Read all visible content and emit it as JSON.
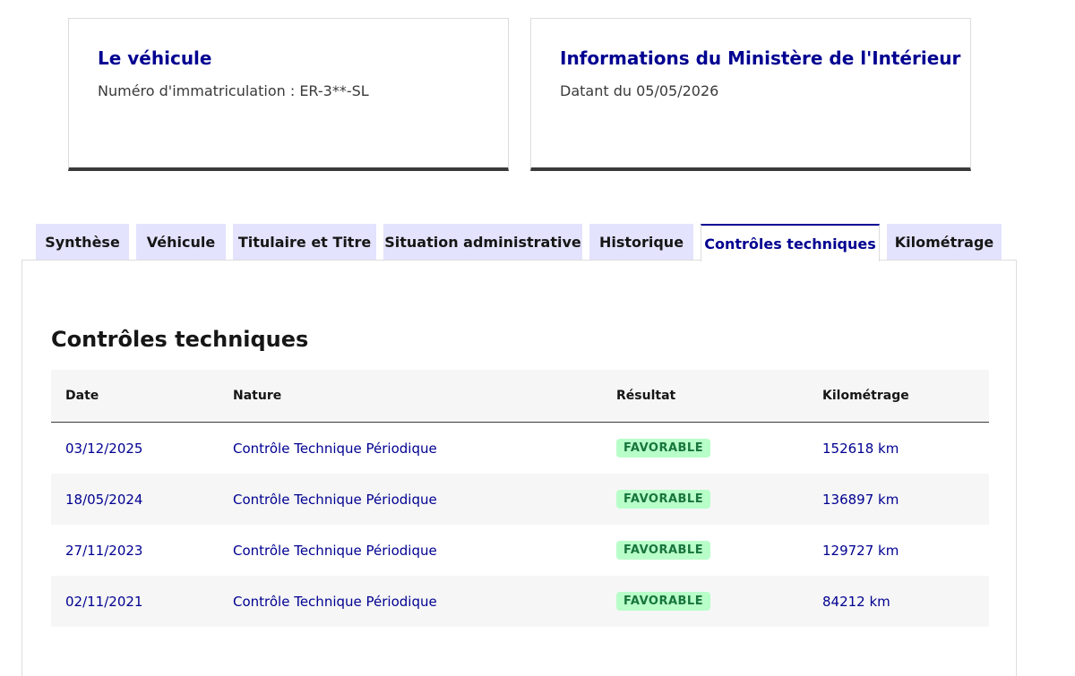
{
  "vehicle_card": {
    "title": "Le véhicule",
    "description": "Numéro d'immatriculation : ER-3**-SL"
  },
  "ministry_card": {
    "title": "Informations du Ministère de l'Intérieur",
    "description": "Datant du 05/05/2026"
  },
  "tabs": [
    {
      "label": "Synthèse"
    },
    {
      "label": "Véhicule"
    },
    {
      "label": "Titulaire et Titre"
    },
    {
      "label": "Situation administrative"
    },
    {
      "label": "Historique"
    },
    {
      "label": "Contrôles techniques",
      "active": true
    },
    {
      "label": "Kilométrage"
    }
  ],
  "panel": {
    "title": "Contrôles techniques",
    "table": {
      "headers": [
        "Date",
        "Nature",
        "Résultat",
        "Kilométrage"
      ],
      "rows": [
        {
          "date": "03/12/2025",
          "nature": "Contrôle Technique Périodique",
          "result": "FAVORABLE",
          "mileage": "152618 km"
        },
        {
          "date": "18/05/2024",
          "nature": "Contrôle Technique Périodique",
          "result": "FAVORABLE",
          "mileage": "136897 km"
        },
        {
          "date": "27/11/2023",
          "nature": "Contrôle Technique Périodique",
          "result": "FAVORABLE",
          "mileage": "129727 km"
        },
        {
          "date": "02/11/2021",
          "nature": "Contrôle Technique Périodique",
          "result": "FAVORABLE",
          "mileage": "84212 km"
        }
      ]
    }
  },
  "colors": {
    "primary_blue": "#000091",
    "tab_background": "#e3e3fd",
    "success_background": "#b8fec9",
    "success_text": "#18753c"
  }
}
